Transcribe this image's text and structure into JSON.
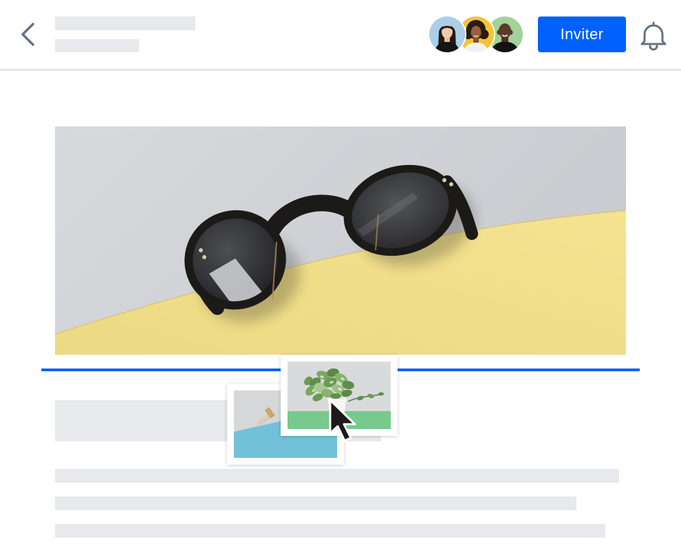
{
  "header": {
    "back_icon": "chevron-left-icon",
    "collaborators": [
      {
        "background": "#a9cfe9"
      },
      {
        "background": "#f3c531"
      },
      {
        "background": "#a2d29a"
      }
    ],
    "invite_button": {
      "label": "Inviter"
    },
    "notification_icon": "bell-icon"
  },
  "drag": {
    "cursor_icon": "arrow-cursor-icon"
  },
  "colors": {
    "accent": "#0061fe",
    "skeleton": "#e7e9ec",
    "divider": "#e4e6e9",
    "icon": "#637282"
  }
}
